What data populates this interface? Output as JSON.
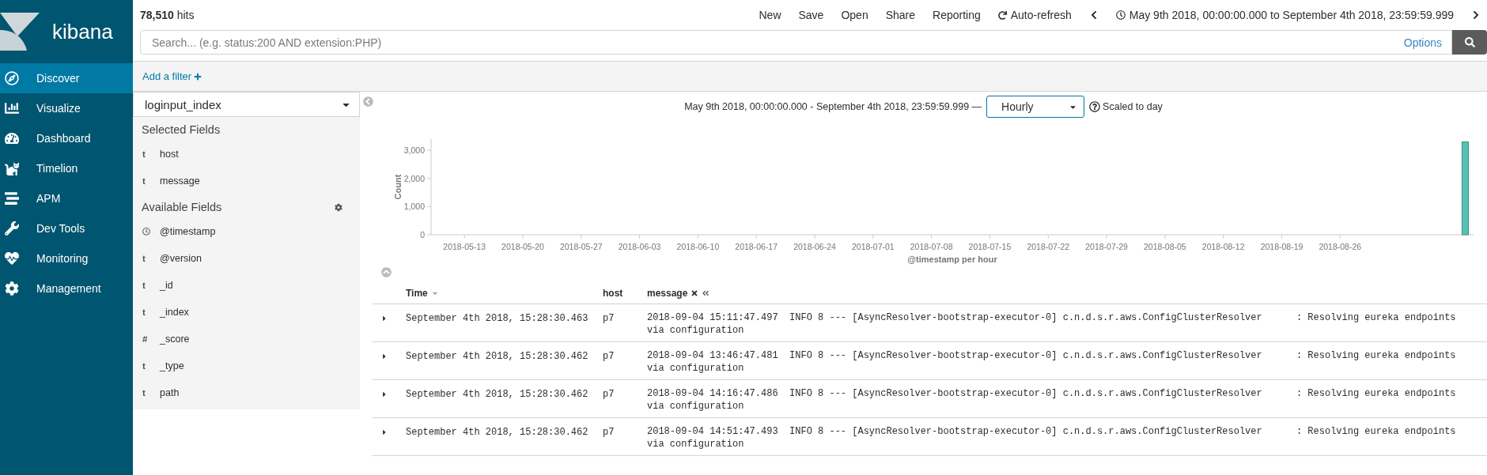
{
  "app": {
    "logo": "kibana"
  },
  "nav": [
    {
      "label": "Discover",
      "selected": true
    },
    {
      "label": "Visualize",
      "selected": false
    },
    {
      "label": "Dashboard",
      "selected": false
    },
    {
      "label": "Timelion",
      "selected": false
    },
    {
      "label": "APM",
      "selected": false
    },
    {
      "label": "Dev Tools",
      "selected": false
    },
    {
      "label": "Monitoring",
      "selected": false
    },
    {
      "label": "Management",
      "selected": false
    }
  ],
  "hits": {
    "count": "78,510",
    "label": "hits"
  },
  "menu": [
    "New",
    "Save",
    "Open",
    "Share",
    "Reporting"
  ],
  "auto_refresh": "Auto-refresh",
  "time_range": "May 9th 2018, 00:00:00.000 to September 4th 2018, 23:59:59.999",
  "search": {
    "placeholder": "Search... (e.g. status:200 AND extension:PHP)",
    "options": "Options"
  },
  "filter": {
    "add": "Add a filter"
  },
  "index_pattern": "loginput_index",
  "selected_fields": {
    "title": "Selected Fields",
    "items": [
      {
        "kind": "text",
        "symbol": "t",
        "name": "host"
      },
      {
        "kind": "text",
        "symbol": "t",
        "name": "message"
      }
    ]
  },
  "available_fields": {
    "title": "Available Fields",
    "items": [
      {
        "kind": "date",
        "name": "@timestamp"
      },
      {
        "kind": "text",
        "symbol": "t",
        "name": "@version"
      },
      {
        "kind": "text",
        "symbol": "t",
        "name": "_id"
      },
      {
        "kind": "text",
        "symbol": "t",
        "name": "_index"
      },
      {
        "kind": "number",
        "symbol": "#",
        "name": "_score"
      },
      {
        "kind": "text",
        "symbol": "t",
        "name": "_type"
      },
      {
        "kind": "text",
        "symbol": "t",
        "name": "path"
      }
    ]
  },
  "histogram": {
    "range": "May 9th 2018, 00:00:00.000 - September 4th 2018, 23:59:59.999 —",
    "interval": "Hourly",
    "scaled": "Scaled to day",
    "chart_data": {
      "type": "bar",
      "xlabel": "@timestamp per hour",
      "ylabel": "Count",
      "xlim": [
        "2018-05-09",
        "2018-09-11"
      ],
      "ylim": [
        0,
        3400
      ],
      "xticks": [
        {
          "value": "2018-05-13",
          "label": "2018-05-13"
        },
        {
          "value": "2018-05-20",
          "label": "2018-05-20"
        },
        {
          "value": "2018-05-27",
          "label": "2018-05-27"
        },
        {
          "value": "2018-06-03",
          "label": "2018-06-03"
        },
        {
          "value": "2018-06-10",
          "label": "2018-06-10"
        },
        {
          "value": "2018-06-17",
          "label": "2018-06-17"
        },
        {
          "value": "2018-06-24",
          "label": "2018-06-24"
        },
        {
          "value": "2018-07-01",
          "label": "2018-07-01"
        },
        {
          "value": "2018-07-08",
          "label": "2018-07-08"
        },
        {
          "value": "2018-07-15",
          "label": "2018-07-15"
        },
        {
          "value": "2018-07-22",
          "label": "2018-07-22"
        },
        {
          "value": "2018-07-29",
          "label": "2018-07-29"
        },
        {
          "value": "2018-08-05",
          "label": "2018-08-05"
        },
        {
          "value": "2018-08-12",
          "label": "2018-08-12"
        },
        {
          "value": "2018-08-19",
          "label": "2018-08-19"
        },
        {
          "value": "2018-08-26",
          "label": "2018-08-26"
        }
      ],
      "yticks": [
        {
          "value": 0,
          "label": "0"
        },
        {
          "value": 1000,
          "label": "1,000"
        },
        {
          "value": 2000,
          "label": "2,000"
        },
        {
          "value": 3000,
          "label": "3,000"
        }
      ],
      "x": [
        "2018-09-10"
      ],
      "values": [
        3300
      ]
    }
  },
  "table": {
    "columns": [
      {
        "label": "Time",
        "sortable": true
      },
      {
        "label": "host",
        "sortable": false
      },
      {
        "label": "message",
        "sortable": false
      }
    ],
    "rows": [
      {
        "time": "September 4th 2018, 15:28:30.463",
        "host": "p7",
        "message": "2018-09-04 15:11:47.497  INFO 8 --- [AsyncResolver-bootstrap-executor-0] c.n.d.s.r.aws.ConfigClusterResolver      : Resolving eureka endpoints\nvia configuration"
      },
      {
        "time": "September 4th 2018, 15:28:30.462",
        "host": "p7",
        "message": "2018-09-04 13:46:47.481  INFO 8 --- [AsyncResolver-bootstrap-executor-0] c.n.d.s.r.aws.ConfigClusterResolver      : Resolving eureka endpoints\nvia configuration"
      },
      {
        "time": "September 4th 2018, 15:28:30.462",
        "host": "p7",
        "message": "2018-09-04 14:16:47.486  INFO 8 --- [AsyncResolver-bootstrap-executor-0] c.n.d.s.r.aws.ConfigClusterResolver      : Resolving eureka endpoints\nvia configuration"
      },
      {
        "time": "September 4th 2018, 15:28:30.462",
        "host": "p7",
        "message": "2018-09-04 14:51:47.493  INFO 8 --- [AsyncResolver-bootstrap-executor-0] c.n.d.s.r.aws.ConfigClusterResolver      : Resolving eureka endpoints\nvia configuration"
      }
    ]
  }
}
